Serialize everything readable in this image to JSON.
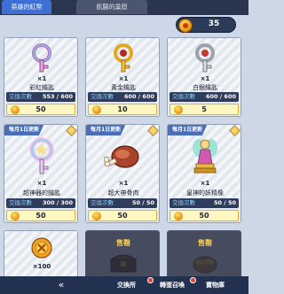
{
  "tabs": [
    {
      "label": "英雄的紅幣",
      "active": true
    },
    {
      "label": "飢腸的巢窟",
      "active": false
    }
  ],
  "currency": {
    "amount": "35",
    "icon": "gold-coin-icon"
  },
  "items": [
    {
      "name": "彩虹鑰匙",
      "quantity": "×1",
      "exchange_label": "交換次數",
      "exchange_value": "553 / 600",
      "price": "50",
      "monthly": false,
      "icon": "rainbow-key-icon"
    },
    {
      "name": "黃金鑰匙",
      "quantity": "×1",
      "exchange_label": "交換次數",
      "exchange_value": "600 / 600",
      "price": "10",
      "monthly": false,
      "icon": "gold-key-icon"
    },
    {
      "name": "白銀鑰匙",
      "quantity": "×1",
      "exchange_label": "交換次數",
      "exchange_value": "600 / 600",
      "price": "5",
      "monthly": false,
      "icon": "silver-key-icon"
    },
    {
      "name": "超神器的鑰匙",
      "quantity": "×1",
      "exchange_label": "交換次數",
      "exchange_value": "300 / 300",
      "price": "50",
      "monthly": true,
      "monthly_label": "每月1日更新",
      "icon": "super-key-icon"
    },
    {
      "name": "超大帶骨肉",
      "quantity": "×1",
      "exchange_label": "交換次數",
      "exchange_value": "50 / 50",
      "price": "50",
      "monthly": true,
      "monthly_label": "每月1日更新",
      "icon": "meat-icon"
    },
    {
      "name": "皇神的妖精像",
      "quantity": "×1",
      "exchange_label": "交換次數",
      "exchange_value": "50 / 50",
      "price": "50",
      "monthly": true,
      "monthly_label": "每月1日更新",
      "icon": "fairy-statue-icon"
    },
    {
      "name": "",
      "quantity": "×100",
      "monthly": false,
      "icon": "coin-stack-icon",
      "sold_out": false
    },
    {
      "name": "",
      "quantity": "",
      "monthly": false,
      "icon": "chest-icon",
      "sold_out": true,
      "sold_label": "售罄"
    },
    {
      "name": "",
      "quantity": "",
      "monthly": false,
      "icon": "gold-bag-icon",
      "sold_out": true,
      "sold_label": "售罄"
    }
  ],
  "bottom_bar": {
    "back": "«",
    "buttons": [
      "交換所",
      "轉蛋召喚",
      "寶物庫"
    ]
  },
  "colors": {
    "header": "#2a3550",
    "tab_active": "#3d6fd6",
    "price_bg": "#fff7c2",
    "monthly_tag": "#4a6fb8"
  }
}
